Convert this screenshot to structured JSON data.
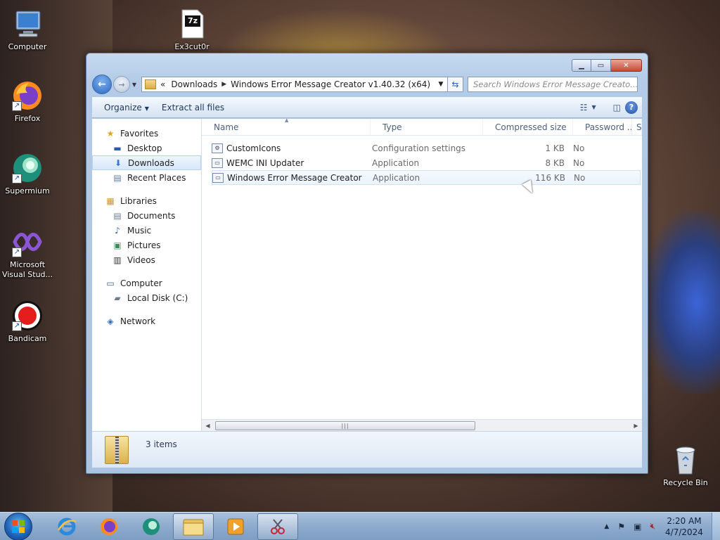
{
  "desktop": {
    "icons": [
      {
        "label": "Computer",
        "icon": "computer-icon"
      },
      {
        "label": "Firefox",
        "icon": "firefox-icon"
      },
      {
        "label": "Supermium",
        "icon": "supermium-icon"
      },
      {
        "label": "Microsoft Visual Stud...",
        "icon": "visual-studio-icon"
      },
      {
        "label": "Bandicam",
        "icon": "bandicam-icon"
      },
      {
        "label": "Ex3cut0r",
        "icon": "7zip-archive-icon"
      },
      {
        "label": "Recycle Bin",
        "icon": "recycle-bin-icon"
      }
    ],
    "archive_badge": "7z"
  },
  "window": {
    "address": {
      "overflow": "«",
      "segments": [
        "Downloads",
        "Windows Error Message Creator v1.40.32 (x64)"
      ]
    },
    "search_placeholder": "Search Windows Error Message Creato...",
    "toolbar": {
      "organize": "Organize",
      "extract": "Extract all files"
    },
    "nav": {
      "favorites": "Favorites",
      "desktop": "Desktop",
      "downloads": "Downloads",
      "recent": "Recent Places",
      "libraries": "Libraries",
      "documents": "Documents",
      "music": "Music",
      "pictures": "Pictures",
      "videos": "Videos",
      "computer": "Computer",
      "localdisk": "Local Disk (C:)",
      "network": "Network"
    },
    "columns": {
      "name": "Name",
      "type": "Type",
      "compressed": "Compressed size",
      "password": "Password ...",
      "size": "Si"
    },
    "files": [
      {
        "name": "CustomIcons",
        "type": "Configuration settings",
        "size": "1 KB",
        "password": "No"
      },
      {
        "name": "WEMC INI Updater",
        "type": "Application",
        "size": "8 KB",
        "password": "No"
      },
      {
        "name": "Windows Error Message Creator",
        "type": "Application",
        "size": "116 KB",
        "password": "No"
      }
    ],
    "status": "3 items"
  },
  "taskbar": {
    "time": "2:20 AM",
    "date": "4/7/2024"
  },
  "colors": {
    "accent": "#2b67c3",
    "selection": "#d7e7fa"
  }
}
